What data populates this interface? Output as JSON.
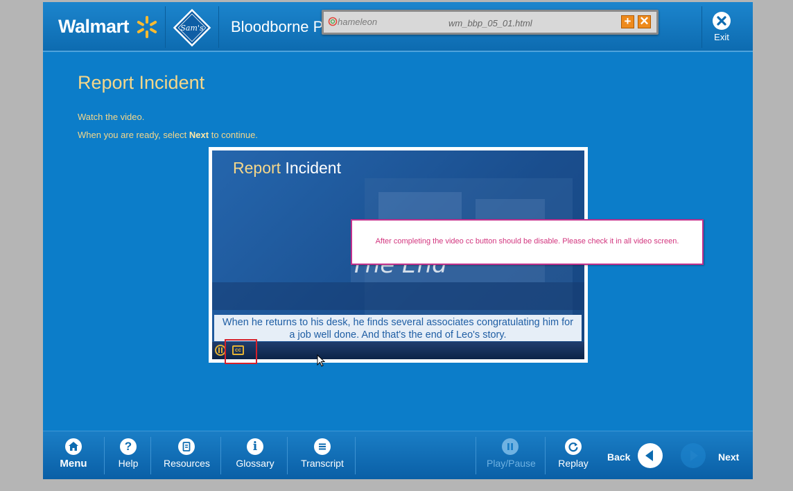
{
  "header": {
    "brand": "Walmart",
    "course_title": "Bloodborne P",
    "exit_label": "Exit"
  },
  "chameleon": {
    "logo_text": "hameleon",
    "filename": "wm_bbp_05_01.html"
  },
  "content": {
    "title": "Report Incident",
    "instruction_1": "Watch the video.",
    "instruction_2_prefix": "When you are ready, select ",
    "instruction_2_bold": "Next",
    "instruction_2_suffix": " to continue."
  },
  "video": {
    "title_accent": "Report",
    "title_rest": " Incident",
    "caption_line_1": "When he returns to his desk, he finds several associates congratulating him for",
    "caption_line_2": "a job well done.  And that's the end of Leo's story.",
    "cc_label": "cc"
  },
  "note": {
    "text": "After completing the video cc button should be disable. Please check it in all video screen."
  },
  "footer": {
    "menu": "Menu",
    "help": "Help",
    "resources": "Resources",
    "glossary": "Glossary",
    "transcript": "Transcript",
    "play_pause": "Play/Pause",
    "replay": "Replay",
    "back": "Back",
    "next": "Next"
  },
  "colors": {
    "background": "#0c7dc9",
    "title_gold": "#f5d78a",
    "note_pink": "#d2357e",
    "highlight_red": "#d6202a"
  }
}
